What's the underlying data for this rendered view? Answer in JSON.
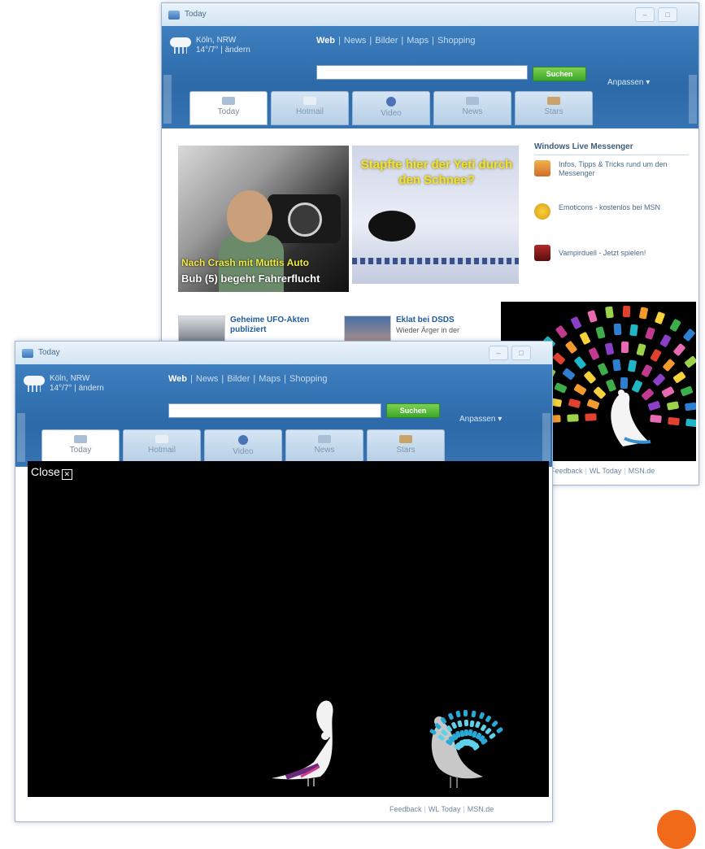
{
  "window_back": {
    "title": "Today",
    "location": "Köln, NRW",
    "weather": "14°/7° | ändern",
    "sources": [
      "Web",
      "News",
      "Bilder",
      "Maps",
      "Shopping"
    ],
    "search_placeholder": "",
    "search_button": "Suchen",
    "customize": "Anpassen ▾",
    "tabs": [
      {
        "label": "Today",
        "icon": "home-icon"
      },
      {
        "label": "Hotmail",
        "icon": "mail-icon"
      },
      {
        "label": "Video",
        "icon": "video-icon"
      },
      {
        "label": "News",
        "icon": "news-icon"
      },
      {
        "label": "Stars",
        "icon": "stars-icon"
      }
    ],
    "hero1": {
      "caption1": "Nach Crash mit Muttis Auto",
      "caption2": "Bub (5) begeht Fahrerflucht"
    },
    "hero2": {
      "caption": "Stapfte hier der Yeti durch den Schnee?"
    },
    "messenger": {
      "heading": "Windows Live Messenger",
      "items": [
        "Infos, Tipps & Tricks rund um den Messenger",
        "Emoticons - kostenlos bei MSN",
        "Vampirduell - Jetzt spielen!"
      ]
    },
    "news": [
      {
        "title": "Geheime UFO-Akten publiziert",
        "subtitle": ""
      },
      {
        "title": "Eklat bei DSDS",
        "subtitle": "Wieder Ärger in der"
      }
    ],
    "footer": [
      "Feedback",
      "WL Today",
      "MSN.de"
    ]
  },
  "window_front": {
    "title": "Today",
    "location": "Köln, NRW",
    "weather": "14°/7° | ändern",
    "sources": [
      "Web",
      "News",
      "Bilder",
      "Maps",
      "Shopping"
    ],
    "search_button": "Suchen",
    "customize": "Anpassen ▾",
    "tabs": [
      {
        "label": "Today",
        "icon": "home-icon"
      },
      {
        "label": "Hotmail",
        "icon": "mail-icon"
      },
      {
        "label": "Video",
        "icon": "video-icon"
      },
      {
        "label": "News",
        "icon": "news-icon"
      },
      {
        "label": "Stars",
        "icon": "stars-icon"
      }
    ],
    "footer": [
      "Feedback",
      "WL Today",
      "MSN.de"
    ]
  },
  "overlay": {
    "close_label": "Close"
  },
  "colors": {
    "header_blue": "#2c69a8",
    "search_green": "#3aa82a",
    "overlay_black": "#000000",
    "badge_orange": "#f16a1a",
    "caption_yellow": "#f3ea3a"
  }
}
